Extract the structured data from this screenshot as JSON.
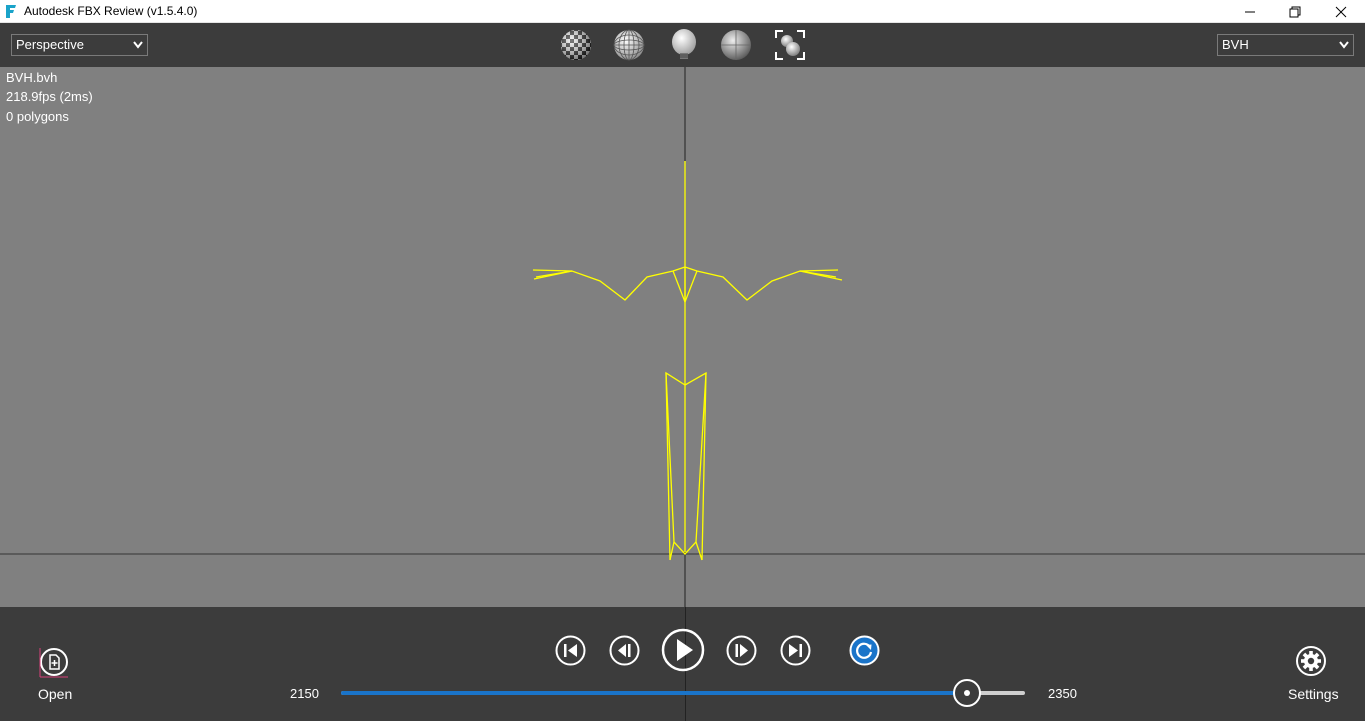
{
  "window": {
    "title": "Autodesk FBX Review (v1.5.4.0)",
    "app_icon": "fbx-logo-icon",
    "controls": [
      "minimize-icon",
      "restore-icon",
      "close-icon"
    ]
  },
  "toolbar": {
    "camera_select": {
      "value": "Perspective"
    },
    "take_select": {
      "value": "BVH"
    },
    "view_modes": [
      "checker-texture-icon",
      "wireframe-sphere-icon",
      "light-bulb-icon",
      "shaded-sphere-icon",
      "frame-all-icon"
    ]
  },
  "viewport": {
    "info": {
      "file": "BVH.bvh",
      "fps": "218.9fps (2ms)",
      "polygons": "0 polygons"
    },
    "background_color": "#808080",
    "skeleton_color": "#ffff00"
  },
  "playback": {
    "open_label": "Open",
    "settings_label": "Settings",
    "buttons": [
      "go-to-start-icon",
      "step-back-icon",
      "play-icon",
      "step-forward-icon",
      "go-to-end-icon",
      "loop-icon"
    ],
    "start_frame": "2150",
    "end_frame": "2350",
    "progress": 0.915,
    "accent_color": "#1a74c9"
  }
}
